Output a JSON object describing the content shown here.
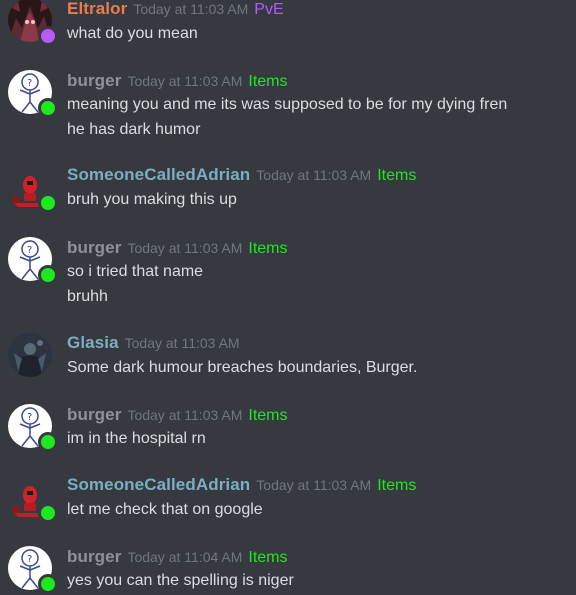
{
  "colors": {
    "background": "#36393f",
    "text": "#dcddde",
    "timestamp": "#72767d",
    "online": "#43b581",
    "online_bright": "#1ee91e",
    "nitro_status": "#b75cf2",
    "eltralor_name": "#e67e51",
    "burger_name": "#8e9297",
    "adrian_name": "#7aaec0",
    "glasia_name": "#7aaec0",
    "tag_pve": "#b15cf2",
    "tag_items": "#1ee91e"
  },
  "messages": [
    {
      "author": "Eltralor",
      "timestamp": "Today at 11:03 AM",
      "tag": "PvE",
      "lines": [
        "what do you mean"
      ],
      "avatar_icon": "demon-avatar-icon",
      "status": "purple"
    },
    {
      "author": "burger",
      "timestamp": "Today at 11:03 AM",
      "tag": "Items",
      "lines": [
        "meaning you and me its was supposed to be for my dying fren",
        "he has dark humor"
      ],
      "avatar_icon": "stickman-avatar-icon",
      "status": "green"
    },
    {
      "author": "SomeoneCalledAdrian",
      "timestamp": "Today at 11:03 AM",
      "tag": "Items",
      "lines": [
        "bruh you making this up"
      ],
      "avatar_icon": "red-robot-avatar-icon",
      "status": "green"
    },
    {
      "author": "burger",
      "timestamp": "Today at 11:03 AM",
      "tag": "Items",
      "lines": [
        "so i tried that name",
        "bruhh"
      ],
      "avatar_icon": "stickman-avatar-icon",
      "status": "green"
    },
    {
      "author": "Glasia",
      "timestamp": "Today at 11:03 AM",
      "tag": "",
      "lines": [
        "Some dark humour breaches boundaries, Burger."
      ],
      "avatar_icon": "dark-figure-avatar-icon",
      "status": "none"
    },
    {
      "author": "burger",
      "timestamp": "Today at 11:03 AM",
      "tag": "Items",
      "lines": [
        "im in the hospital rn"
      ],
      "avatar_icon": "stickman-avatar-icon",
      "status": "green"
    },
    {
      "author": "SomeoneCalledAdrian",
      "timestamp": "Today at 11:03 AM",
      "tag": "Items",
      "lines": [
        "let me check that on google"
      ],
      "avatar_icon": "red-robot-avatar-icon",
      "status": "green"
    },
    {
      "author": "burger",
      "timestamp": "Today at 11:04 AM",
      "tag": "Items",
      "lines": [
        "yes you can the spelling is niger"
      ],
      "avatar_icon": "stickman-avatar-icon",
      "status": "green"
    }
  ]
}
